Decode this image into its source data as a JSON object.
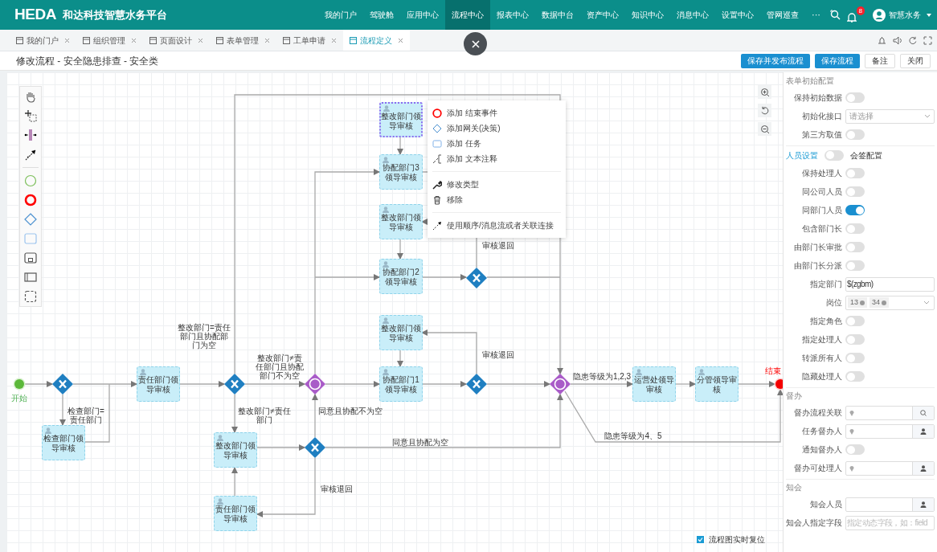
{
  "header": {
    "logo": "HEDA",
    "app_title": "和达科技智慧水务平台",
    "nav": [
      {
        "label": "我的门户",
        "selected": false
      },
      {
        "label": "驾驶舱",
        "selected": false
      },
      {
        "label": "应用中心",
        "selected": false
      },
      {
        "label": "流程中心",
        "selected": true
      },
      {
        "label": "报表中心",
        "selected": false
      },
      {
        "label": "数据中台",
        "selected": false
      },
      {
        "label": "资产中心",
        "selected": false
      },
      {
        "label": "知识中心",
        "selected": false
      },
      {
        "label": "消息中心",
        "selected": false
      },
      {
        "label": "设置中心",
        "selected": false
      },
      {
        "label": "管网巡查",
        "selected": false
      }
    ],
    "more": "···",
    "notification_count": "8",
    "user": "智慧水务"
  },
  "tabs": [
    {
      "label": "我的门户",
      "selected": false
    },
    {
      "label": "组织管理",
      "selected": false
    },
    {
      "label": "页面设计",
      "selected": false
    },
    {
      "label": "表单管理",
      "selected": false
    },
    {
      "label": "工单申请",
      "selected": false
    },
    {
      "label": "流程定义",
      "selected": true
    }
  ],
  "page": {
    "title": "修改流程 - 安全隐患排查 - 安全类",
    "buttons": [
      {
        "label": "保存并发布流程",
        "kind": "primary"
      },
      {
        "label": "保存流程",
        "kind": "primary"
      },
      {
        "label": "备注",
        "kind": "plain"
      },
      {
        "label": "关闭",
        "kind": "plain"
      }
    ]
  },
  "diagram": {
    "nodes": [
      {
        "kind": "start",
        "label": "开始"
      },
      {
        "kind": "exclusive"
      },
      {
        "kind": "task",
        "label": "检查部门领导审核",
        "selected": false
      },
      {
        "kind": "task",
        "label": "责任部门领导审核",
        "selected": false
      },
      {
        "kind": "exclusive"
      },
      {
        "kind": "inclusive"
      },
      {
        "kind": "task",
        "label": "整改部门领导审核",
        "selected": false
      },
      {
        "kind": "exclusive"
      },
      {
        "kind": "task",
        "label": "责任部门领导审核",
        "selected": false
      },
      {
        "kind": "task",
        "label": "整改部门领导审核",
        "selected": true
      },
      {
        "kind": "task",
        "label": "协配部门3领导审核",
        "selected": false
      },
      {
        "kind": "task",
        "label": "整改部门领导审核",
        "selected": false
      },
      {
        "kind": "task",
        "label": "协配部门2领导审核",
        "selected": false
      },
      {
        "kind": "exclusive"
      },
      {
        "kind": "task",
        "label": "整改部门领导审核",
        "selected": false
      },
      {
        "kind": "task",
        "label": "协配部门1领导审核",
        "selected": false
      },
      {
        "kind": "exclusive"
      },
      {
        "kind": "inclusive"
      },
      {
        "kind": "task",
        "label": "运营处领导审核",
        "selected": false
      },
      {
        "kind": "task",
        "label": "分管领导审核",
        "selected": false
      },
      {
        "kind": "end",
        "label": "结束"
      }
    ],
    "edge_labels": [
      "检查部门=责任部门",
      "整改部门=责任部门且协配部门为空",
      "整改部门≠责任部门且协配部门不为空",
      "整改部门≠责任部门",
      "同意且协配不为空",
      "同意且协配为空",
      "审核退回",
      "审核退回",
      "审核退回",
      "隐患等级为1,2,3",
      "隐患等级为4、5"
    ],
    "context_menu": {
      "groups": [
        [
          "添加 结束事件",
          "添加网关(决策)",
          "添加 任务",
          "添加 文本注释"
        ],
        [
          "修改类型",
          "移除"
        ],
        [
          "使用顺序/消息流或者关联连接"
        ]
      ]
    },
    "reset_option": {
      "label": "流程图实时复位",
      "checked": true
    }
  },
  "properties": {
    "rows": [
      {
        "kind": "section",
        "label": "表单初始配置"
      },
      {
        "kind": "toggle",
        "label": "保持初始数据",
        "on": false
      },
      {
        "kind": "select",
        "label": "初始化接口",
        "placeholder": "请选择"
      },
      {
        "kind": "toggle",
        "label": "第三方取值",
        "on": false
      },
      {
        "kind": "header_toggle",
        "label": "人员设置",
        "on": false,
        "after": "会签配置"
      },
      {
        "kind": "toggle",
        "label": "保持处理人",
        "on": false
      },
      {
        "kind": "toggle",
        "label": "同公司人员",
        "on": false
      },
      {
        "kind": "toggle",
        "label": "同部门人员",
        "on": true
      },
      {
        "kind": "toggle",
        "label": "包含部门长",
        "on": false
      },
      {
        "kind": "toggle",
        "label": "由部门长审批",
        "on": false
      },
      {
        "kind": "toggle",
        "label": "由部门长分派",
        "on": false
      },
      {
        "kind": "input",
        "label": "指定部门",
        "value": "$(zgbm)"
      },
      {
        "kind": "tags",
        "label": "岗位",
        "tags": [
          "13",
          "34"
        ]
      },
      {
        "kind": "toggle",
        "label": "指定角色",
        "on": false
      },
      {
        "kind": "toggle",
        "label": "指定处理人",
        "on": false
      },
      {
        "kind": "toggle",
        "label": "转派所有人",
        "on": false
      },
      {
        "kind": "toggle",
        "label": "隐藏处理人",
        "on": false
      },
      {
        "kind": "section",
        "label": "督办"
      },
      {
        "kind": "search_lookup",
        "label": "督办流程关联"
      },
      {
        "kind": "user_lookup",
        "label": "任务督办人"
      },
      {
        "kind": "toggle",
        "label": "通知督办人",
        "on": false
      },
      {
        "kind": "user_lookup",
        "label": "督办可处理人"
      },
      {
        "kind": "section",
        "label": "知会"
      },
      {
        "kind": "user_lookup_plain",
        "label": "知会人员"
      },
      {
        "kind": "input",
        "label": "知会人指定字段",
        "placeholder": "指定动态字段，如：field"
      }
    ]
  }
}
